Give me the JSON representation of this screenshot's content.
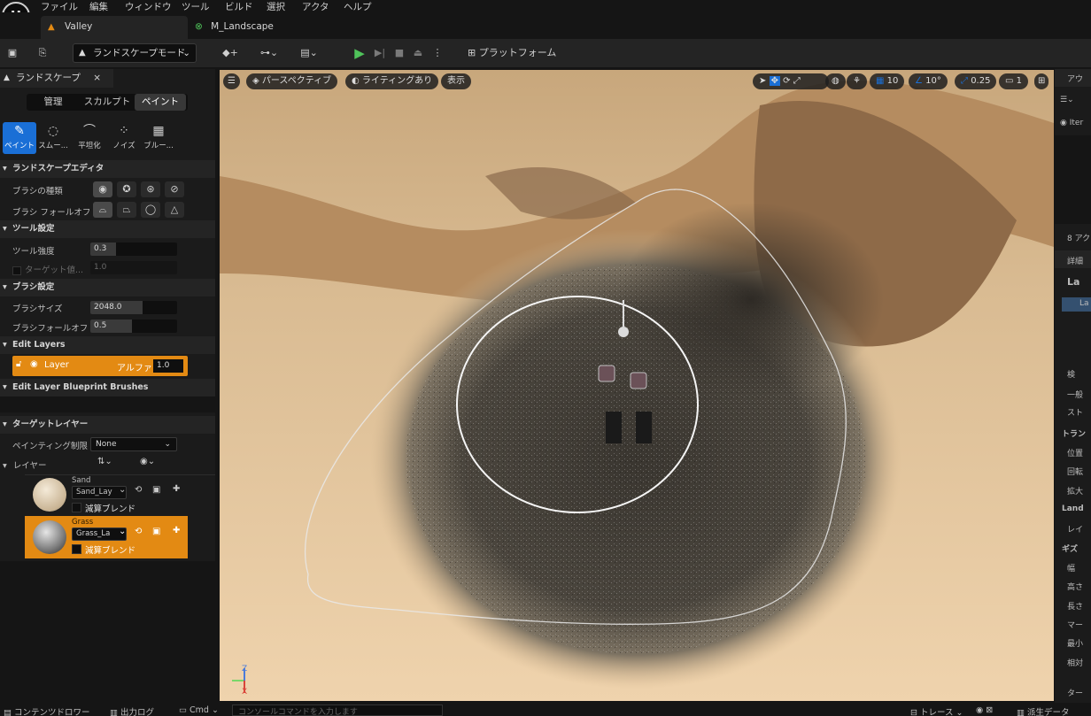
{
  "menu": [
    "ファイル",
    "編集",
    "ウィンドウ",
    "ツール",
    "ビルド",
    "選択",
    "アクタ",
    "ヘルプ"
  ],
  "logo": "U",
  "tabs": [
    {
      "label": "Valley"
    },
    {
      "label": "M_Landscape"
    }
  ],
  "toolbar": {
    "mode": "ランドスケープモード",
    "platform": "プラットフォーム"
  },
  "left_panel": {
    "title": "ランドスケープ",
    "close": "×",
    "modes": [
      "管理",
      "スカルプト",
      "ペイント"
    ],
    "tools": [
      "ペイント",
      "スムー...",
      "平坦化",
      "ノイズ",
      "ブルー..."
    ],
    "sections": {
      "landscape_editor": "ランドスケープエディタ",
      "tool_settings": "ツール設定",
      "brush_settings": "ブラシ設定",
      "edit_layers": "Edit Layers",
      "edit_layer_bp": "Edit Layer Blueprint Brushes",
      "target_layers": "ターゲットレイヤー"
    },
    "brush_type_label": "ブラシの種類",
    "brush_falloff_label": "ブラシ フォールオフ",
    "tool_strength_label": "ツール強度",
    "tool_strength": "0.3",
    "tool_strength_level": 0.3,
    "target_value_label": "ターゲット値...",
    "target_value": "1.0",
    "brush_size_label": "ブラシサイズ",
    "brush_size": "2048.0",
    "brush_falloff2_label": "ブラシフォールオフ",
    "brush_falloff": "0.5",
    "brush_falloff_level": 0.5,
    "layer_name": "Layer",
    "alpha_label": "アルファ",
    "alpha_value": "1.0",
    "paint_restriction_label": "ペインティング制限",
    "paint_restriction": "None",
    "layers_label": "レイヤー",
    "layers": [
      {
        "name": "Sand",
        "asset": "Sand_Lay",
        "blend": "減算ブレンド",
        "selected": false
      },
      {
        "name": "Grass",
        "asset": "Grass_La",
        "blend": "減算ブレンド",
        "selected": true
      }
    ]
  },
  "viewport": {
    "perspective": "パースペクティブ",
    "lighting": "ライティングあり",
    "show": "表示",
    "grid_snap": "10",
    "rot_snap": "10°",
    "scale_snap": "0.25",
    "camera_speed": "1"
  },
  "right_panel": {
    "items": [
      "アウ",
      "Iter",
      "8 アク",
      "詳細",
      "La",
      "La",
      "検",
      "一般",
      "スト",
      "トラン",
      "位置",
      "回転",
      "拡大",
      "Land",
      "レイ",
      "ギズ",
      "幅",
      "高さ",
      "長さ",
      "マー",
      "最小",
      "相対",
      "ター"
    ]
  },
  "statusbar": {
    "content_drawer": "コンテンツドロワー",
    "output_log": "出力ログ",
    "cmd": "Cmd",
    "console_placeholder": "コンソールコマンドを入力します",
    "trace": "トレース",
    "derived_data": "派生データ"
  },
  "colors": {
    "accent_orange": "#e38a13",
    "panel": "#1b1b1b",
    "toolbar": "#242424",
    "play_green": "#4fc35a"
  }
}
